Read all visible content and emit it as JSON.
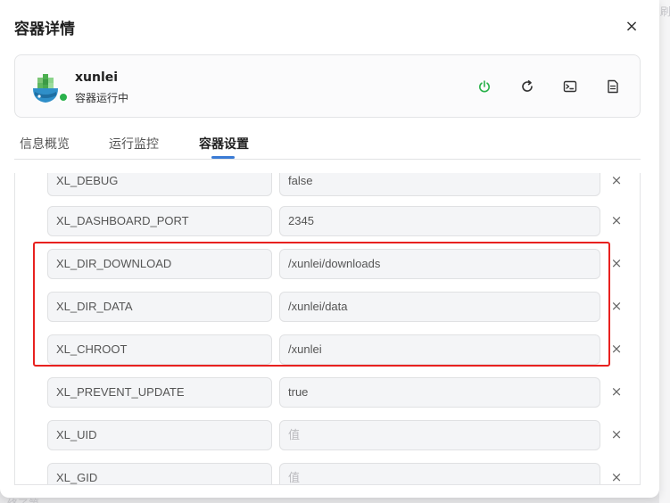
{
  "dialog": {
    "title": "容器详情",
    "close_symbol": "×"
  },
  "container": {
    "name": "xunlei",
    "status": "容器运行中",
    "status_color": "#2bb24c",
    "actions": [
      {
        "name": "power-icon",
        "color": "#2bb24c"
      },
      {
        "name": "restart-icon",
        "color": "#333333"
      },
      {
        "name": "terminal-icon",
        "color": "#333333"
      },
      {
        "name": "log-icon",
        "color": "#333333"
      }
    ]
  },
  "tabs": [
    {
      "label": "信息概览",
      "active": false
    },
    {
      "label": "运行监控",
      "active": false
    },
    {
      "label": "容器设置",
      "active": true
    }
  ],
  "env": {
    "placeholder": "值",
    "remove_symbol": "×",
    "rows": [
      {
        "key": "XL_DEBUG",
        "value": "false"
      },
      {
        "key": "XL_DASHBOARD_PORT",
        "value": "2345"
      },
      {
        "key": "XL_DIR_DOWNLOAD",
        "value": "/xunlei/downloads"
      },
      {
        "key": "XL_DIR_DATA",
        "value": "/xunlei/data"
      },
      {
        "key": "XL_CHROOT",
        "value": "/xunlei"
      },
      {
        "key": "XL_PREVENT_UPDATE",
        "value": "true"
      },
      {
        "key": "XL_UID",
        "value": ""
      },
      {
        "key": "XL_GID",
        "value": ""
      }
    ]
  },
  "annotation": {
    "color": "#e8211f"
  },
  "background": {
    "right_char": "刷",
    "bottom_text": "终了第"
  }
}
